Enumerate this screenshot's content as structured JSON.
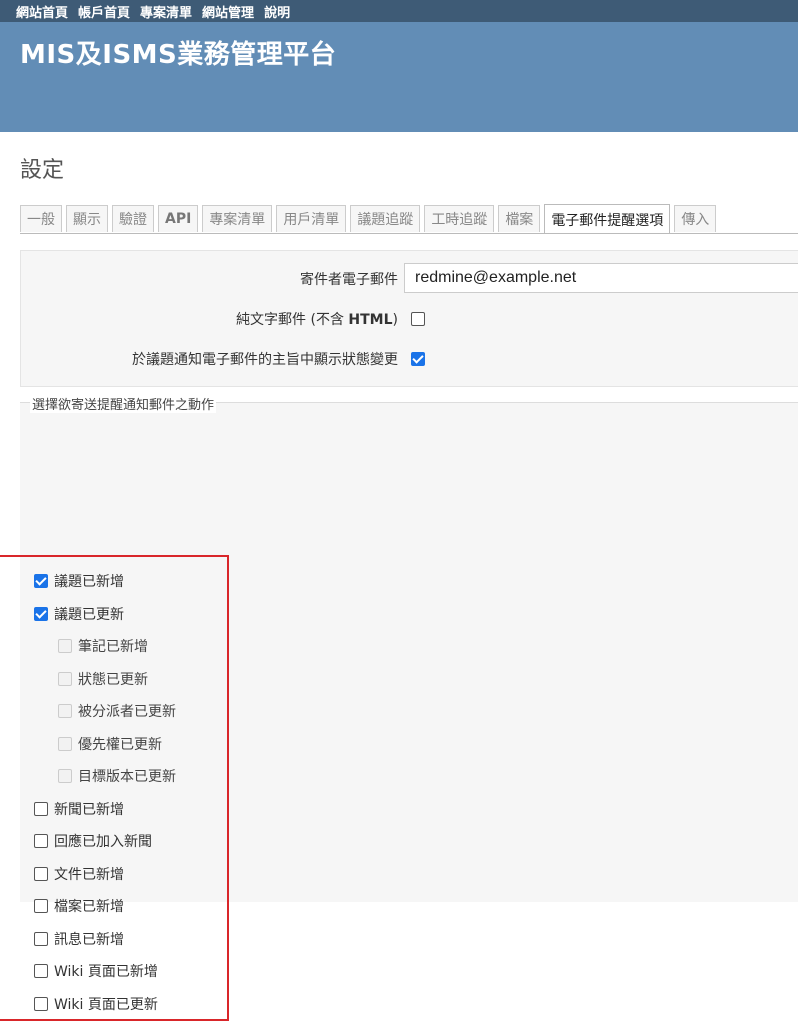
{
  "top_menu": [
    "網站首頁",
    "帳戶首頁",
    "專案清單",
    "網站管理",
    "說明"
  ],
  "header": {
    "title": "MIS及ISMS業務管理平台"
  },
  "page_title": "設定",
  "tabs": [
    {
      "label": "一般"
    },
    {
      "label": "顯示"
    },
    {
      "label": "驗證"
    },
    {
      "label": "API"
    },
    {
      "label": "專案清單"
    },
    {
      "label": "用戶清單"
    },
    {
      "label": "議題追蹤"
    },
    {
      "label": "工時追蹤"
    },
    {
      "label": "檔案"
    },
    {
      "label": "電子郵件提醒選項"
    },
    {
      "label": "傳入"
    }
  ],
  "selected_tab": "電子郵件提醒選項",
  "email": {
    "sender_label": "寄件者電子郵件",
    "sender_value": "redmine@example.net",
    "plain_text_label_prefix": "純文字郵件 (不含 ",
    "plain_text_label_html": "HTML",
    "plain_text_label_suffix": ")",
    "plain_text_checked": false,
    "status_in_subject_label": "於議題通知電子郵件的主旨中顯示狀態變更",
    "status_in_subject_checked": true
  },
  "notifications": {
    "legend": "選擇欲寄送提醒通知郵件之動作",
    "items": [
      {
        "label": "議題已新增",
        "checked": true,
        "sub": false
      },
      {
        "label": "議題已更新",
        "checked": true,
        "sub": false
      },
      {
        "label": "筆記已新增",
        "checked": false,
        "sub": true
      },
      {
        "label": "狀態已更新",
        "checked": false,
        "sub": true
      },
      {
        "label": "被分派者已更新",
        "checked": false,
        "sub": true
      },
      {
        "label": "優先權已更新",
        "checked": false,
        "sub": true
      },
      {
        "label": "目標版本已更新",
        "checked": false,
        "sub": true
      },
      {
        "label": "新聞已新增",
        "checked": false,
        "sub": false
      },
      {
        "label": "回應已加入新聞",
        "checked": false,
        "sub": false
      },
      {
        "label": "文件已新增",
        "checked": false,
        "sub": false
      },
      {
        "label": "檔案已新增",
        "checked": false,
        "sub": false
      },
      {
        "label": "訊息已新增",
        "checked": false,
        "sub": false
      },
      {
        "label": "Wiki 頁面已新增",
        "checked": false,
        "sub": false
      },
      {
        "label": "Wiki 頁面已更新",
        "checked": false,
        "sub": false
      }
    ]
  },
  "colors": {
    "top_menu_bg": "#3e5b76",
    "header_bg": "#628db6",
    "checkbox_checked": "#1a73e8",
    "highlight_border": "#d9262a"
  }
}
